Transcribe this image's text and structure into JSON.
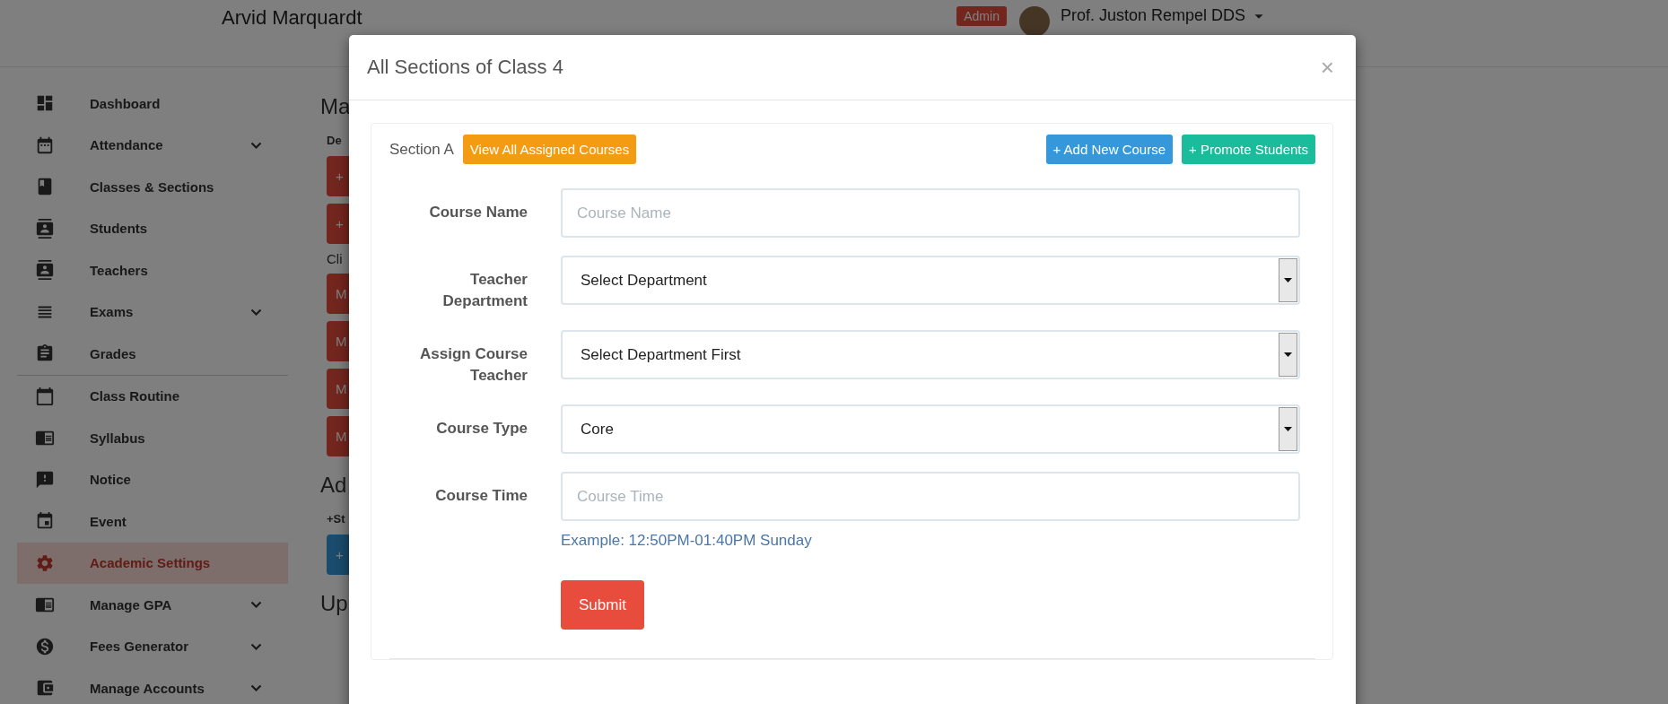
{
  "header": {
    "user_name": "Arvid Marquardt",
    "role_badge": "Admin",
    "profile_name": "Prof. Juston Rempel DDS"
  },
  "sidebar": {
    "groups": [
      {
        "items": [
          {
            "label": "Dashboard",
            "expandable": false,
            "selected": false
          },
          {
            "label": "Attendance",
            "expandable": true,
            "selected": false
          },
          {
            "label": "Classes & Sections",
            "expandable": false,
            "selected": false
          },
          {
            "label": "Students",
            "expandable": false,
            "selected": false
          },
          {
            "label": "Teachers",
            "expandable": false,
            "selected": false
          },
          {
            "label": "Exams",
            "expandable": true,
            "selected": false
          },
          {
            "label": "Grades",
            "expandable": false,
            "selected": false
          }
        ]
      },
      {
        "items": [
          {
            "label": "Class Routine",
            "expandable": false,
            "selected": false
          },
          {
            "label": "Syllabus",
            "expandable": false,
            "selected": false
          },
          {
            "label": "Notice",
            "expandable": false,
            "selected": false
          },
          {
            "label": "Event",
            "expandable": false,
            "selected": false
          },
          {
            "label": "Academic Settings",
            "expandable": false,
            "selected": true
          },
          {
            "label": "Manage GPA",
            "expandable": true,
            "selected": false
          },
          {
            "label": "Fees Generator",
            "expandable": true,
            "selected": false
          },
          {
            "label": "Manage Accounts",
            "expandable": true,
            "selected": false
          }
        ]
      }
    ]
  },
  "background_content": [
    {
      "kind": "heading",
      "text": "Ma"
    },
    {
      "kind": "label",
      "text": "De"
    },
    {
      "kind": "danger",
      "text": "+"
    },
    {
      "kind": "danger",
      "text": "+"
    },
    {
      "kind": "text",
      "text": "Cli"
    },
    {
      "kind": "danger",
      "text": "M"
    },
    {
      "kind": "danger",
      "text": "M"
    },
    {
      "kind": "danger",
      "text": "M"
    },
    {
      "kind": "danger",
      "text": "M"
    },
    {
      "kind": "heading",
      "text": "Ad"
    },
    {
      "kind": "label",
      "text": "+St"
    },
    {
      "kind": "primary",
      "text": "+"
    },
    {
      "kind": "heading",
      "text": "Up"
    }
  ],
  "modal": {
    "title": "All Sections of Class 4",
    "close": "×",
    "section": {
      "label": "Section A",
      "actions": [
        {
          "label": "View All Assigned Courses",
          "color": "#f39c12"
        },
        {
          "label": "+ Add New Course",
          "color": "#3498db"
        },
        {
          "label": "+ Promote Students",
          "color": "#1abc9c"
        }
      ],
      "fields": [
        {
          "kind": "text",
          "label": "Course Name",
          "placeholder": "Course Name"
        },
        {
          "kind": "select",
          "label": "Teacher Department",
          "value": "Select Department"
        },
        {
          "kind": "select",
          "label": "Assign Course Teacher",
          "value": "Select Department First"
        },
        {
          "kind": "select",
          "label": "Course Type",
          "value": "Core"
        },
        {
          "kind": "text",
          "label": "Course Time",
          "placeholder": "Course Time",
          "help": "Example: 12:50PM-01:40PM Sunday"
        }
      ],
      "submit": "Submit"
    }
  }
}
